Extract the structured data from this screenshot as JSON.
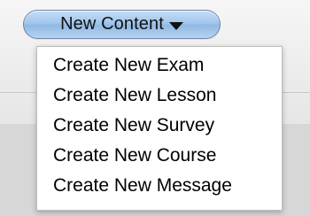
{
  "new_content_button": {
    "label": "New Content",
    "icon": "chevron-down-icon",
    "color": "#9cc3eb"
  },
  "menu": {
    "items": [
      {
        "label": "Create New Exam"
      },
      {
        "label": "Create New Lesson"
      },
      {
        "label": "Create New Survey"
      },
      {
        "label": "Create New Course"
      },
      {
        "label": "Create New Message"
      }
    ]
  }
}
